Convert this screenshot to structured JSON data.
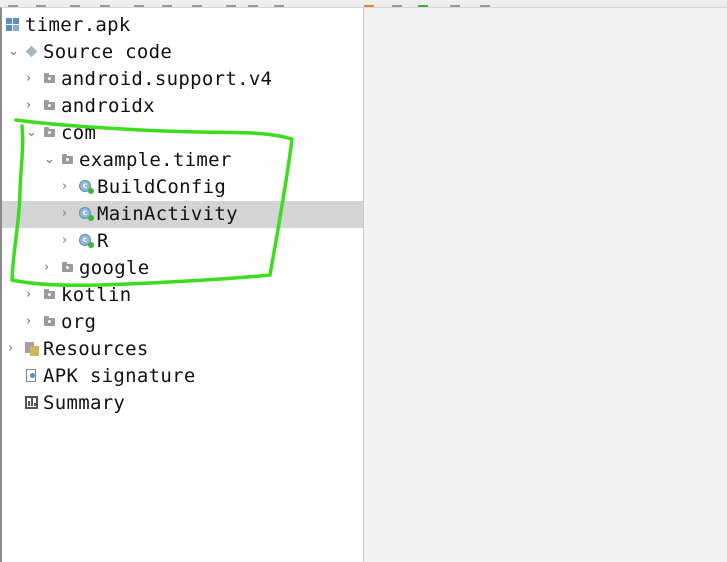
{
  "tree": {
    "root": {
      "label": "timer.apk",
      "icon": "apk-file-icon"
    },
    "source_code": {
      "label": "Source code",
      "icon": "package-icon"
    },
    "android_support": {
      "label": "android.support.v4"
    },
    "androidx": {
      "label": "androidx"
    },
    "com": {
      "label": "com"
    },
    "example_timer": {
      "label": "example.timer"
    },
    "build_config": {
      "label": "BuildConfig",
      "badge": "c"
    },
    "main_activity": {
      "label": "MainActivity",
      "badge": "c",
      "selected": true
    },
    "r": {
      "label": "R",
      "badge": "c"
    },
    "google": {
      "label": "google"
    },
    "kotlin": {
      "label": "kotlin"
    },
    "org": {
      "label": "org"
    },
    "resources": {
      "label": "Resources",
      "icon": "resources-icon"
    },
    "apk_signature": {
      "label": "APK signature",
      "icon": "signature-icon"
    },
    "summary": {
      "label": "Summary",
      "icon": "summary-icon"
    }
  },
  "colors": {
    "selection": "#d4d4d4",
    "annotation": "#3ddc1e",
    "class_badge": "#8fbad6",
    "class_dot": "#3fb53f"
  }
}
